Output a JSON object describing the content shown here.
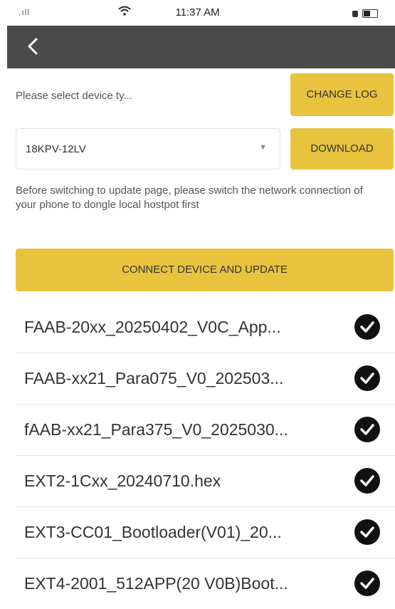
{
  "status_bar": {
    "signal": ".ıll",
    "time": "11:37 AM"
  },
  "header": {
    "back_icon": "chevron-left-icon"
  },
  "device": {
    "select_label": "Please select device ty...",
    "selected_value": "18KPV-12LV",
    "change_log_label": "CHANGE LOG",
    "download_label": "DOWNLOAD"
  },
  "note": "Before switching to update page, please switch the network connection of your phone to dongle local hostpot first",
  "connect_button_label": "CONNECT DEVICE AND UPDATE",
  "colors": {
    "accent": "#e8c33e",
    "nav_bg": "#4a4a4a"
  },
  "files": [
    {
      "name": "FAAB-20xx_20250402_V0C_App...",
      "checked": true
    },
    {
      "name": "FAAB-xx21_Para075_V0_202503...",
      "checked": true
    },
    {
      "name": "fAAB-xx21_Para375_V0_2025030...",
      "checked": true
    },
    {
      "name": "EXT2-1Cxx_20240710.hex",
      "checked": true
    },
    {
      "name": "EXT3-CC01_Bootloader(V01)_20...",
      "checked": true
    },
    {
      "name": "EXT4-2001_512APP(20 V0B)Boot...",
      "checked": true
    }
  ]
}
